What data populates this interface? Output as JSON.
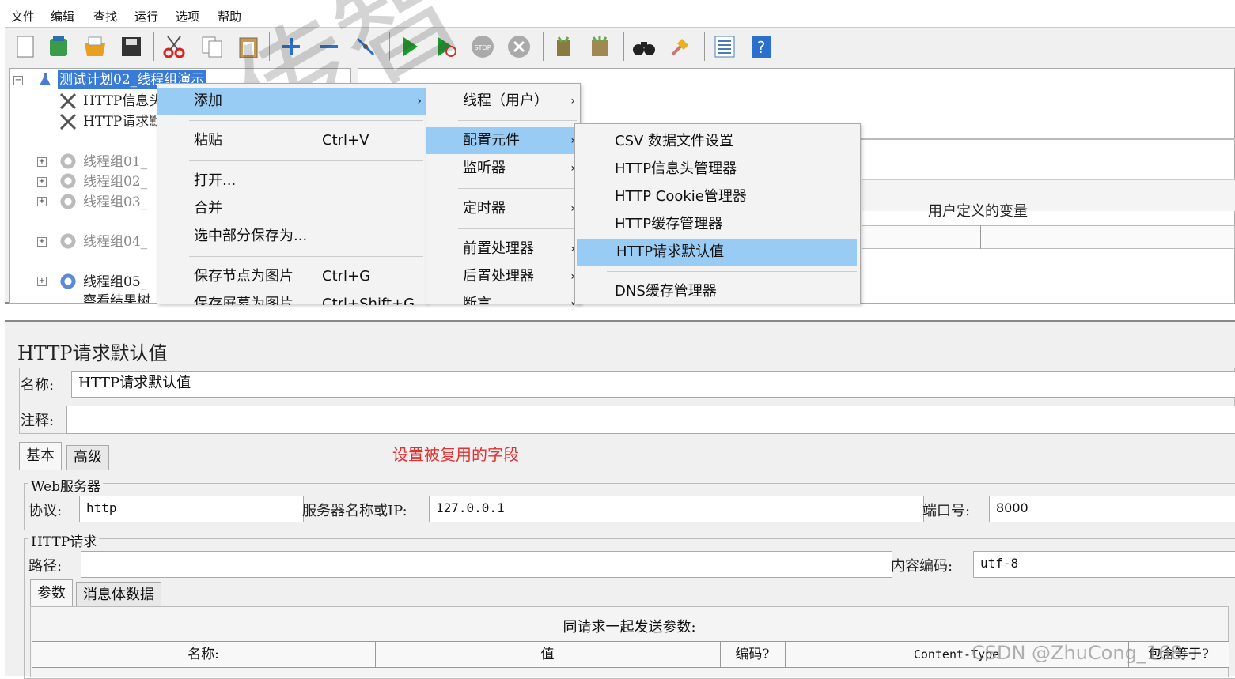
{
  "menubar": {
    "items": [
      "文件",
      "编辑",
      "查找",
      "运行",
      "选项",
      "帮助"
    ]
  },
  "tree": {
    "root": "测试计划02_线程组演示",
    "items": [
      "HTTP信息头",
      "HTTP请求默",
      "线程组01_",
      "线程组02_",
      "线程组03_",
      "线程组04_",
      "线程组05_",
      "察看结果树"
    ]
  },
  "context_menu": {
    "items": [
      {
        "label": "添加",
        "shortcut": ""
      },
      {
        "label": "粘贴",
        "shortcut": "Ctrl+V"
      },
      {
        "label": "打开...",
        "shortcut": ""
      },
      {
        "label": "合并",
        "shortcut": ""
      },
      {
        "label": "选中部分保存为...",
        "shortcut": ""
      },
      {
        "label": "保存节点为图片",
        "shortcut": "Ctrl+G"
      },
      {
        "label": "保存屏幕为图片",
        "shortcut": "Ctrl+Shift+G"
      }
    ]
  },
  "add_submenu": {
    "items": [
      "线程（用户）",
      "配置元件",
      "监听器",
      "定时器",
      "前置处理器",
      "后置处理器",
      "断言"
    ]
  },
  "config_submenu": {
    "items": [
      "CSV 数据文件设置",
      "HTTP信息头管理器",
      "HTTP Cookie管理器",
      "HTTP缓存管理器",
      "HTTP请求默认值",
      "DNS缓存管理器"
    ]
  },
  "user_vars_label": "用户定义的变量",
  "watermark": "传智",
  "panel": {
    "title": "HTTP请求默认值",
    "name_label": "名称:",
    "name_value": "HTTP请求默认值",
    "comment_label": "注释:",
    "comment_value": "",
    "tabs": [
      "基本",
      "高级"
    ],
    "annotation": "设置被复用的字段",
    "web_server": {
      "legend": "Web服务器",
      "protocol_label": "协议:",
      "protocol_value": "http",
      "server_label": "服务器名称或IP:",
      "server_value": "127.0.0.1",
      "port_label": "端口号:",
      "port_value": "8000"
    },
    "http_request": {
      "legend": "HTTP请求",
      "path_label": "路径:",
      "path_value": "",
      "encoding_label": "内容编码:",
      "encoding_value": "utf-8"
    },
    "sub_tabs": [
      "参数",
      "消息体数据"
    ],
    "params_caption": "同请求一起发送参数:",
    "table_headers": [
      "名称:",
      "值",
      "编码?",
      "Content-Type",
      "包含等于?"
    ]
  },
  "credit": "CSDN @ZhuCong_168",
  "colors": {
    "highlight": "#99ccf5",
    "annotation": "#e03030",
    "selection": "#3a7bd5"
  }
}
